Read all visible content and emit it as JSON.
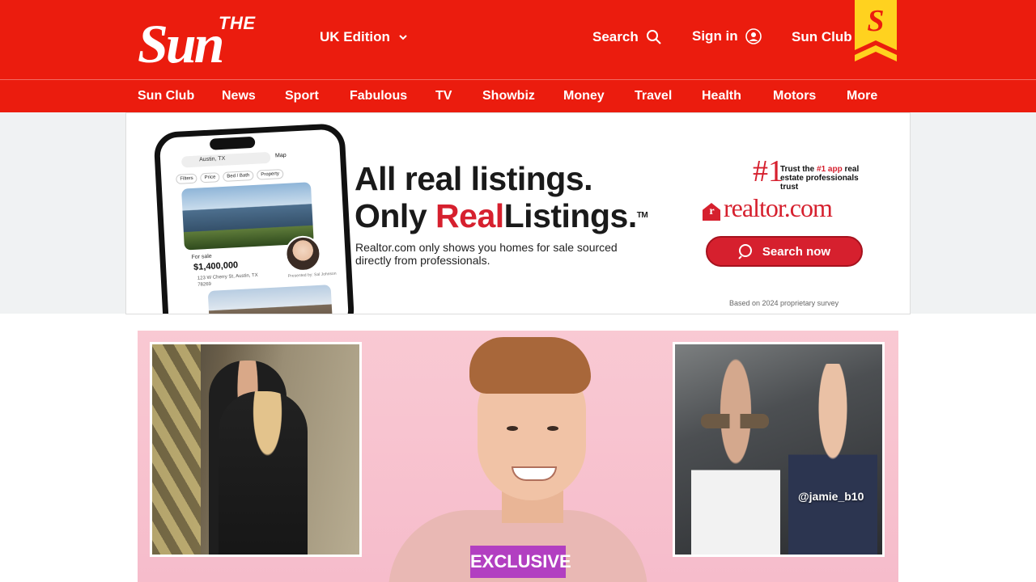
{
  "header": {
    "logo_small": "THE",
    "logo_big": "Sun",
    "edition": "UK Edition",
    "search_label": "Search",
    "signin_label": "Sign in",
    "sunclub_label": "Sun Club",
    "brand_color": "#eb1c0e"
  },
  "nav": {
    "items": [
      "Sun Club",
      "News",
      "Sport",
      "Fabulous",
      "TV",
      "Showbiz",
      "Money",
      "Travel",
      "Health",
      "Motors",
      "More"
    ]
  },
  "ad": {
    "headline_line1": "All real listings.",
    "headline_only": "Only ",
    "headline_real": "Real",
    "headline_listings": "Listings.",
    "headline_tm": "TM",
    "subtext": "Realtor.com only shows you homes for sale sourced directly from professionals.",
    "rank": "#1",
    "trust_prefix": "Trust the ",
    "trust_highlight": "#1 app",
    "trust_suffix": " real estate professionals trust",
    "brand": "realtor.com",
    "cta": "Search now",
    "disclaimer": "Based on 2024 proprietary survey",
    "accent_color": "#d6202e",
    "phone": {
      "search": "Austin, TX",
      "map": "Map",
      "chips": [
        "Filters",
        "Price",
        "Bed / Bath",
        "Property"
      ],
      "status": "For sale",
      "price": "$1,400,000",
      "address": "123 W Cherry St, Austin, TX 78269",
      "presented": "Presented by: Sal Johnson"
    }
  },
  "hero": {
    "badge": "EXCLUSIVE",
    "handle": "@jamie_b10",
    "badge_color": "#b23fc1"
  }
}
